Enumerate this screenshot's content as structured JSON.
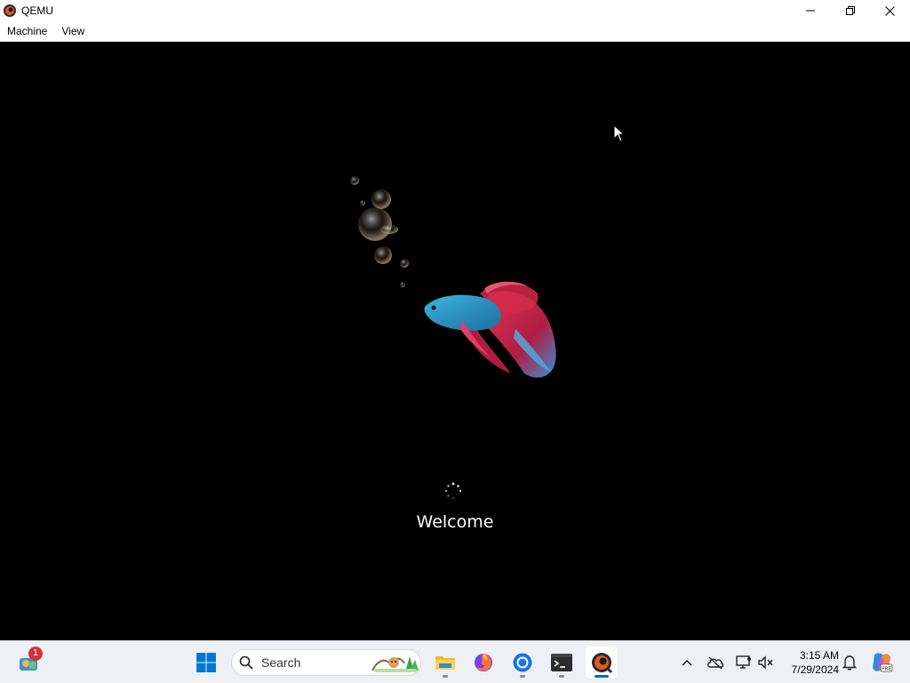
{
  "window": {
    "title": "QEMU",
    "icon": "qemu-icon",
    "controls": [
      "minimize-icon",
      "restore-icon",
      "close-icon"
    ]
  },
  "menubar": {
    "items": [
      {
        "label": "Machine"
      },
      {
        "label": "View"
      }
    ]
  },
  "screen": {
    "background": "#000000",
    "welcome_text": "Welcome",
    "spinner": "loading-spinner-icon",
    "wallpaper_art": "betta-fish-with-bubbles"
  },
  "taskbar": {
    "widgets": {
      "icon": "widgets-icon",
      "badge": "1"
    },
    "start_icon": "windows-start-icon",
    "search": {
      "label": "Search",
      "icon": "search-icon"
    },
    "apps": [
      {
        "name": "file-explorer",
        "icon": "folder-icon",
        "running": true,
        "active": false
      },
      {
        "name": "firefox",
        "icon": "firefox-icon",
        "running": false,
        "active": false
      },
      {
        "name": "chrome",
        "icon": "chrome-icon",
        "running": true,
        "active": false
      },
      {
        "name": "terminal",
        "icon": "terminal-icon",
        "running": true,
        "active": false
      },
      {
        "name": "qemu",
        "icon": "qemu-icon",
        "running": true,
        "active": true
      }
    ],
    "tray": {
      "overflow_icon": "chevron-up-icon",
      "icons": [
        "onedrive-offline-icon",
        "network-icon",
        "volume-muted-icon"
      ],
      "time": "3:15 AM",
      "date": "7/29/2024",
      "notification_icon": "bell-icon",
      "copilot_icon": "copilot-icon",
      "copilot_badge": "PRE"
    },
    "accent": "#0067c0"
  }
}
